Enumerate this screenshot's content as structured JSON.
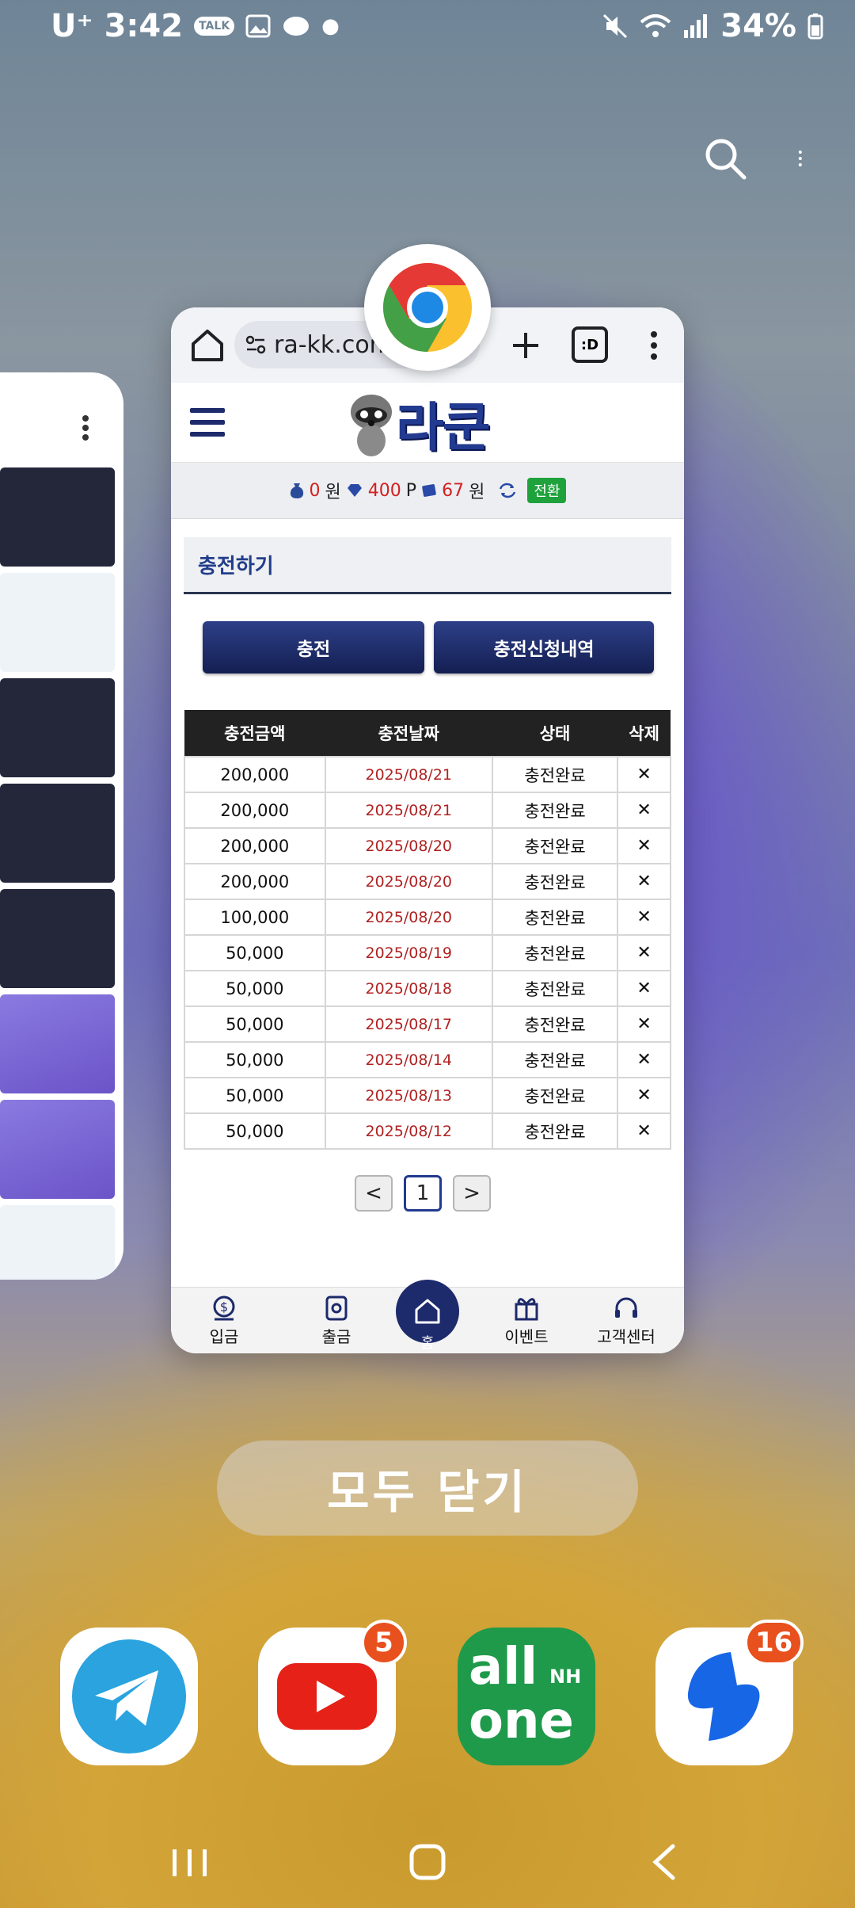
{
  "status": {
    "carrier": "U⁺",
    "time": "3:42",
    "talk_badge": "TALK",
    "battery": "34%"
  },
  "browser": {
    "url": "ra-kk.com",
    "tabs_label": ":D"
  },
  "site": {
    "logo": "라쿤",
    "points": {
      "money": "0",
      "money_unit": "원",
      "point": "400",
      "point_unit": "P",
      "chip": "67",
      "chip_unit": "원",
      "switch_label": "전환"
    },
    "section_title": "충전하기",
    "buttons": {
      "charge": "충전",
      "history": "충전신청내역"
    },
    "table": {
      "headers": [
        "충전금액",
        "충전날짜",
        "상태",
        "삭제"
      ],
      "rows": [
        {
          "amount": "200,000",
          "date": "2025/08/21",
          "status": "충전완료",
          "del": "✕"
        },
        {
          "amount": "200,000",
          "date": "2025/08/21",
          "status": "충전완료",
          "del": "✕"
        },
        {
          "amount": "200,000",
          "date": "2025/08/20",
          "status": "충전완료",
          "del": "✕"
        },
        {
          "amount": "200,000",
          "date": "2025/08/20",
          "status": "충전완료",
          "del": "✕"
        },
        {
          "amount": "100,000",
          "date": "2025/08/20",
          "status": "충전완료",
          "del": "✕"
        },
        {
          "amount": "50,000",
          "date": "2025/08/19",
          "status": "충전완료",
          "del": "✕"
        },
        {
          "amount": "50,000",
          "date": "2025/08/18",
          "status": "충전완료",
          "del": "✕"
        },
        {
          "amount": "50,000",
          "date": "2025/08/17",
          "status": "충전완료",
          "del": "✕"
        },
        {
          "amount": "50,000",
          "date": "2025/08/14",
          "status": "충전완료",
          "del": "✕"
        },
        {
          "amount": "50,000",
          "date": "2025/08/13",
          "status": "충전완료",
          "del": "✕"
        },
        {
          "amount": "50,000",
          "date": "2025/08/12",
          "status": "충전완료",
          "del": "✕"
        }
      ]
    },
    "pager": {
      "prev": "<",
      "current": "1",
      "next": ">"
    },
    "nav": {
      "deposit": "입금",
      "withdraw": "출금",
      "home": "홈",
      "event": "이벤트",
      "support": "고객센터"
    }
  },
  "recents": {
    "close_all": "모두 닫기"
  },
  "dock": {
    "youtube_badge": "5",
    "messenger_badge": "16",
    "allone_line1": "all",
    "allone_line2": "one",
    "allone_nh": "NH"
  },
  "colors": {
    "brand_navy": "#1d2a6b",
    "accent_red": "#d32020",
    "switch_green": "#1fa23c",
    "badge_orange": "#e8501e"
  }
}
